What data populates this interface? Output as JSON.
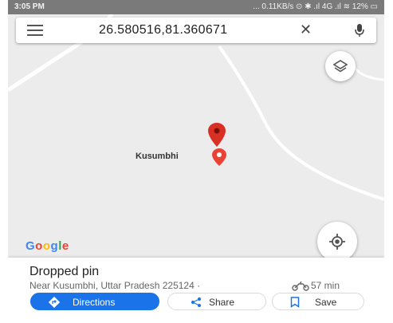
{
  "statusbar": {
    "time": "3:05 PM",
    "right": "... 0.11KB/s ⊙ ✱ .ıl 4G .ıl ≋ 12% ▭"
  },
  "search": {
    "query": "26.580516,81.360671",
    "menu_icon": "menu-icon",
    "close_icon": "close-icon",
    "mic_icon": "mic-icon"
  },
  "map": {
    "place_label": "Kusumbhi",
    "logo_text": "Google",
    "layers_icon": "layers-icon",
    "locate_icon": "my-location-icon",
    "pin_color": "#d93025"
  },
  "card": {
    "title": "Dropped pin",
    "address": "Near Kusumbhi, Uttar Pradesh 225124 ·",
    "eta": "57 min",
    "buttons": {
      "directions": "Directions",
      "share": "Share",
      "save": "Save"
    }
  },
  "colors": {
    "accent": "#1a73e8",
    "map_bg": "#ececec",
    "road": "#ffffff"
  }
}
